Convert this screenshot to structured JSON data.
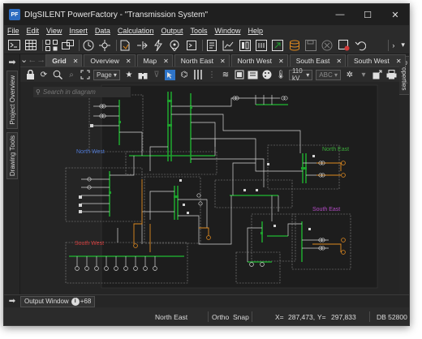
{
  "window": {
    "app_icon": "PF",
    "title": "DIgSILENT PowerFactory - \"Transmission System\"",
    "controls": {
      "minimize": "—",
      "maximize": "☐",
      "close": "✕"
    }
  },
  "menu": [
    "File",
    "Edit",
    "View",
    "Insert",
    "Data",
    "Calculation",
    "Output",
    "Tools",
    "Window",
    "Help"
  ],
  "toolbar": {
    "icons": [
      "terminal-icon",
      "grid-icon",
      "network-icon",
      "data-manager-icon",
      "clock-icon",
      "move-icon",
      "new-diagram-icon",
      "load-flow-icon",
      "short-circuit-icon",
      "location-icon",
      "script-icon",
      "report-icon",
      "chart-icon",
      "panel-icon",
      "compare-icon",
      "export-icon",
      "database-icon",
      "save-icon",
      "cancel-icon",
      "edit-icon",
      "undo-icon",
      "more-icon",
      "expand-icon"
    ]
  },
  "left_dock": {
    "tabs": [
      "Project Overview",
      "Drawing Tools"
    ]
  },
  "right_dock": {
    "tabs": [
      "Properties"
    ]
  },
  "tabs": [
    {
      "label": "Grid",
      "active": true
    },
    {
      "label": "Overview",
      "active": false
    },
    {
      "label": "Map",
      "active": false
    },
    {
      "label": "North East",
      "active": false
    },
    {
      "label": "North West",
      "active": false
    },
    {
      "label": "South East",
      "active": false
    },
    {
      "label": "South West",
      "active": false
    }
  ],
  "tab_close": "✕",
  "tab_add": "+",
  "diagram_toolbar": {
    "page_select": "Page",
    "voltage_select": "110 kV",
    "text_select": "ABC"
  },
  "canvas": {
    "search_placeholder": "Search in diagram",
    "region_labels": [
      {
        "text": "North West",
        "color": "#4f79d4"
      },
      {
        "text": "North East",
        "color": "#3aa83a"
      },
      {
        "text": "South East",
        "color": "#b24bc4"
      },
      {
        "text": "South West",
        "color": "#d43a3a"
      }
    ],
    "bus_color": "#1fa12e",
    "line_color": "#dcdcdc",
    "transformer_color": "#e08a1f",
    "background": "#252525"
  },
  "output": {
    "tab_label": "Output Window",
    "badge": "i",
    "count": "+68"
  },
  "status": {
    "region": "North East",
    "ortho": "Ortho",
    "snap": "Snap",
    "x_label": "X=",
    "x_value": "287,473,",
    "y_label": "Y=",
    "y_value": "297,833",
    "db": "DB 52800"
  }
}
